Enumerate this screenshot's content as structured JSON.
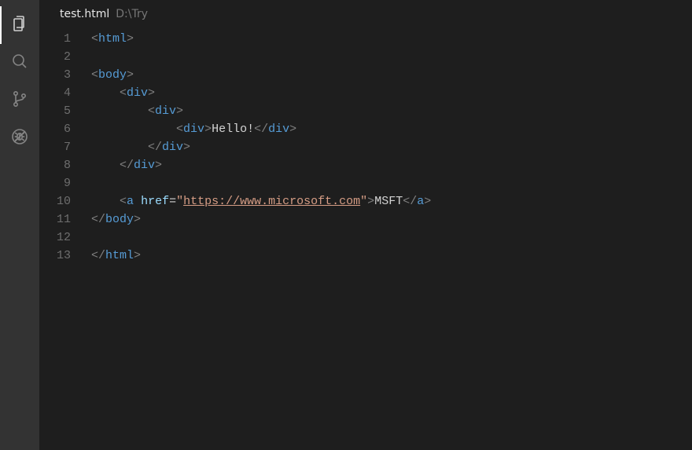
{
  "tab": {
    "filename": "test.html",
    "path": "D:\\Try"
  },
  "lines": [
    {
      "n": "1",
      "indent": 0,
      "kind": "open",
      "tag": "html"
    },
    {
      "n": "2",
      "indent": 0,
      "kind": "blank"
    },
    {
      "n": "3",
      "indent": 0,
      "kind": "open",
      "tag": "body"
    },
    {
      "n": "4",
      "indent": 1,
      "kind": "open",
      "tag": "div"
    },
    {
      "n": "5",
      "indent": 2,
      "kind": "open",
      "tag": "div"
    },
    {
      "n": "6",
      "indent": 3,
      "kind": "wrap",
      "tag": "div",
      "text": "Hello!"
    },
    {
      "n": "7",
      "indent": 2,
      "kind": "close",
      "tag": "div"
    },
    {
      "n": "8",
      "indent": 1,
      "kind": "close",
      "tag": "div"
    },
    {
      "n": "9",
      "indent": 0,
      "kind": "blank"
    },
    {
      "n": "10",
      "indent": 1,
      "kind": "anchor",
      "tag": "a",
      "attr": "href",
      "url": "https://www.microsoft.com",
      "text": "MSFT"
    },
    {
      "n": "11",
      "indent": 0,
      "kind": "close",
      "tag": "body"
    },
    {
      "n": "12",
      "indent": 0,
      "kind": "blank"
    },
    {
      "n": "13",
      "indent": 0,
      "kind": "close",
      "tag": "html"
    }
  ]
}
